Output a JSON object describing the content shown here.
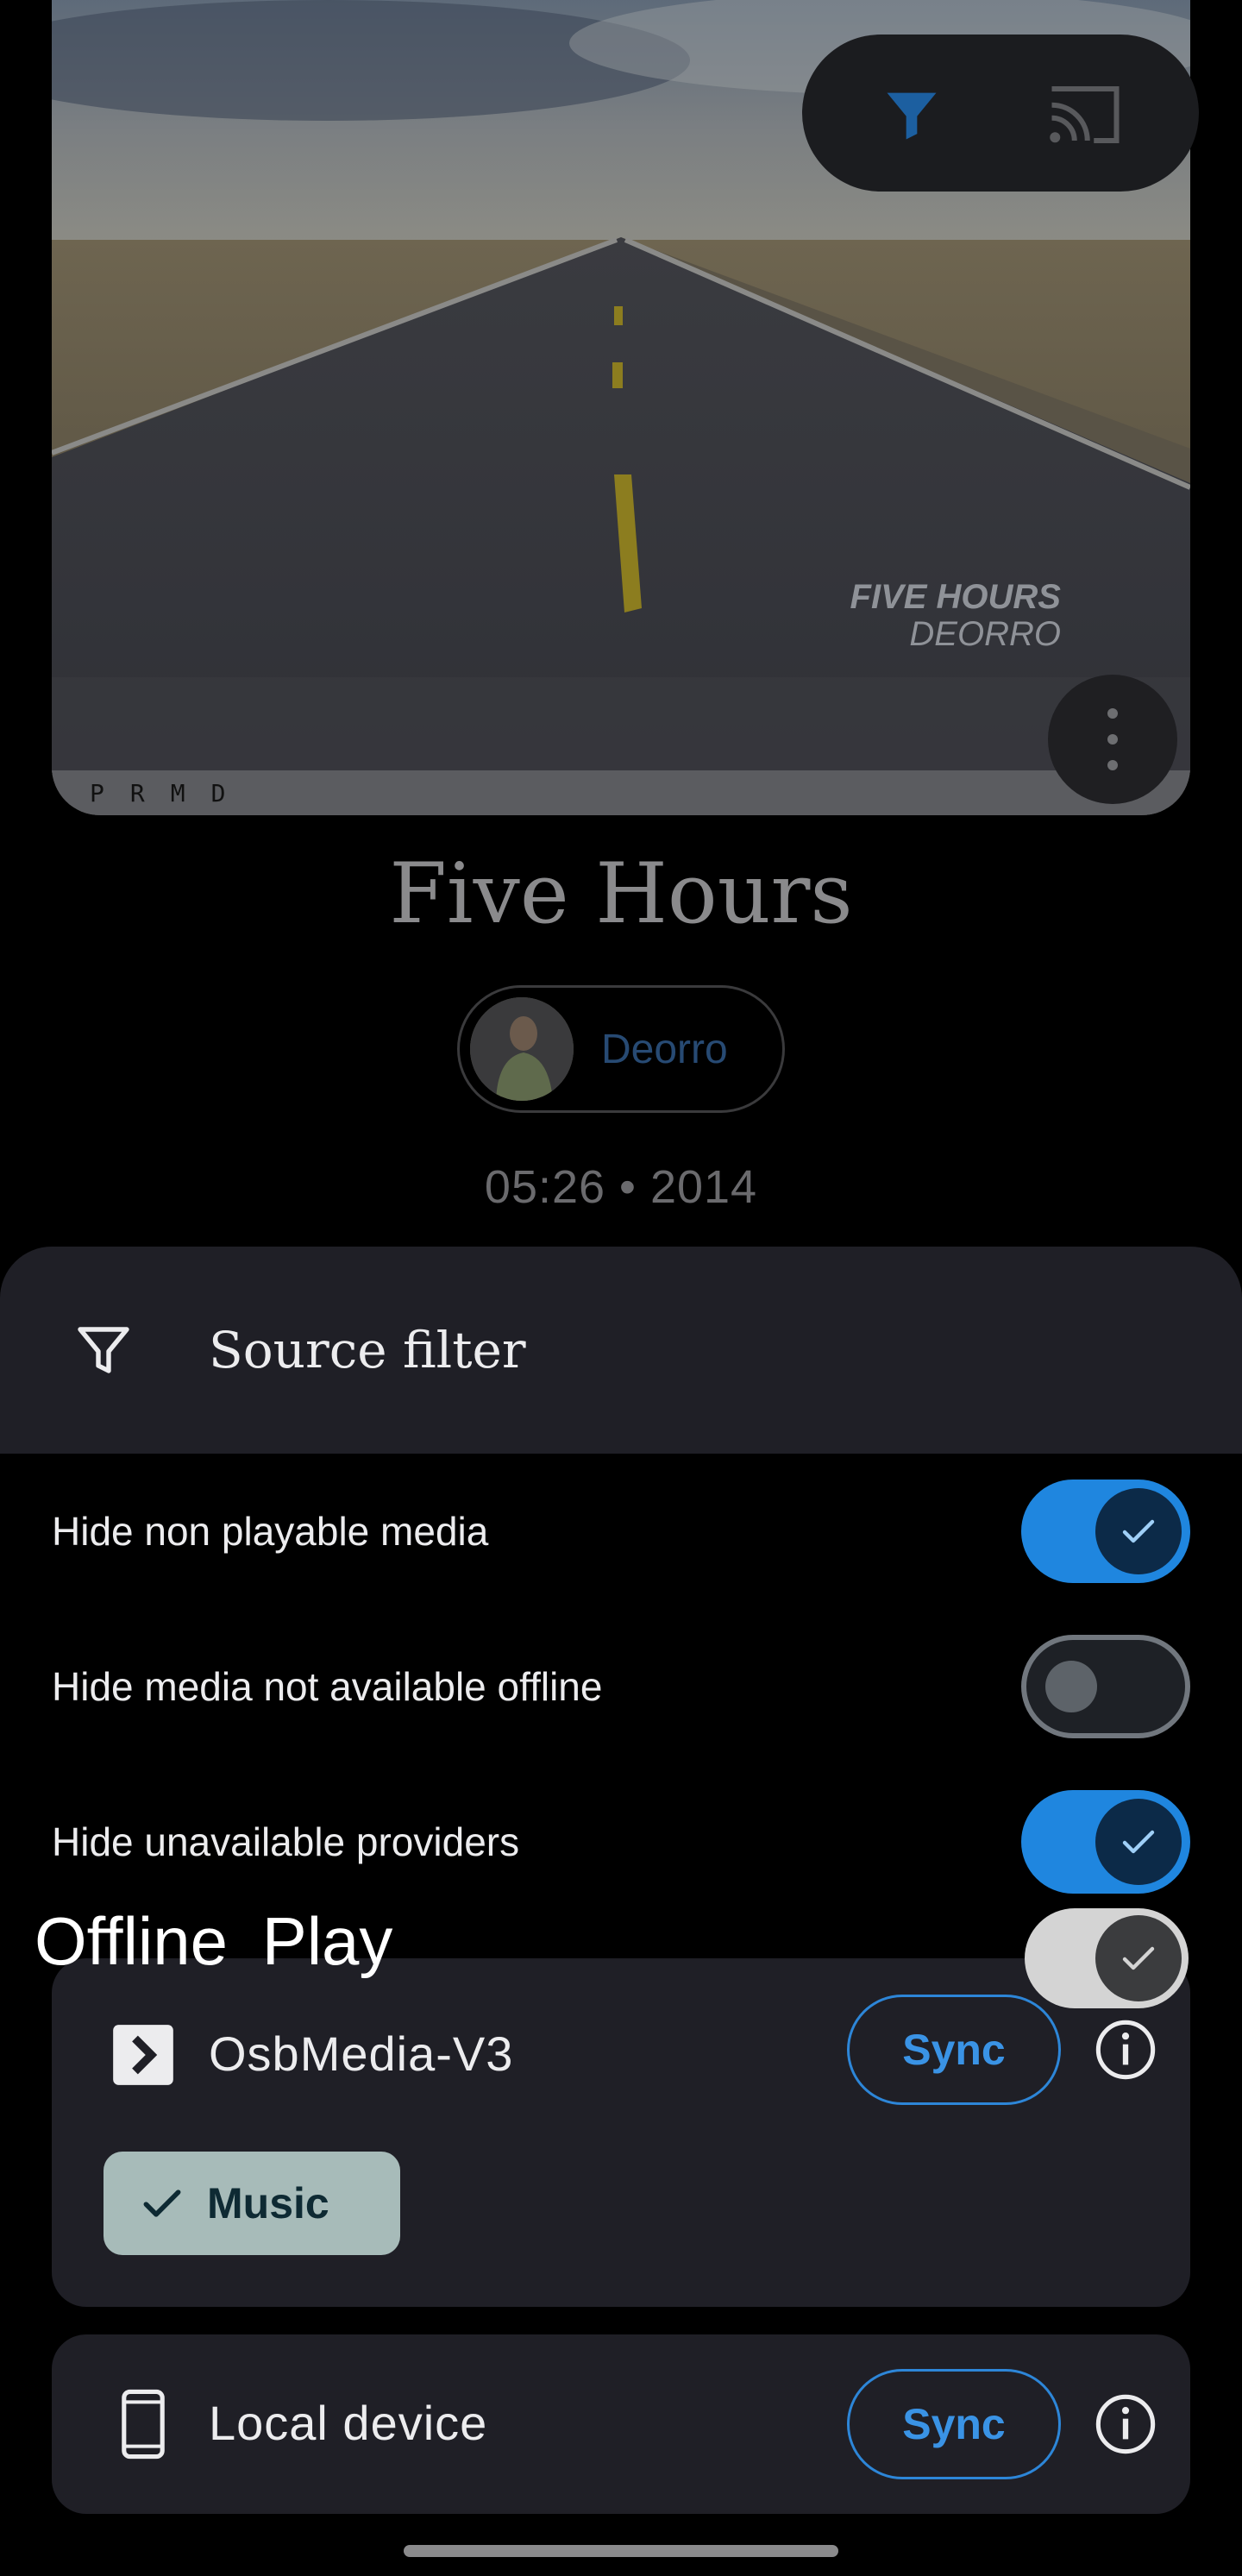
{
  "background": {
    "album_art": {
      "caption_line1": "FIVE HOURS",
      "caption_line2": "DEORRO",
      "label_strip": "PRMD",
      "more_icon": "more-vertical-icon"
    },
    "top_actions": {
      "filter_icon": "filter-icon",
      "cast_icon": "cast-icon",
      "filter_color": "#1f86df"
    },
    "track": {
      "title": "Five Hours",
      "artist": "Deorro",
      "meta": "05:26 • 2014"
    }
  },
  "sheet": {
    "header": {
      "icon": "filter-outline-icon",
      "title": "Source filter"
    },
    "toggles": [
      {
        "label": "Hide non playable media",
        "on": true
      },
      {
        "label": "Hide media not available offline",
        "on": false
      },
      {
        "label": "Hide unavailable providers",
        "on": true
      }
    ],
    "offline_play": {
      "label": "Offline  Play",
      "on": true
    },
    "providers": [
      {
        "name": "OsbMedia-V3",
        "icon": "jellyfin-chevron-icon",
        "sync_label": "Sync",
        "info_icon": "info-icon",
        "chips": [
          {
            "label": "Music",
            "selected": true
          }
        ]
      },
      {
        "name": "Local device",
        "icon": "phone-icon",
        "sync_label": "Sync",
        "info_icon": "info-icon"
      }
    ]
  },
  "colors": {
    "accent": "#1f86df",
    "sheet_surface": "#1f1f26",
    "chip_bg": "#a7bbb9"
  }
}
